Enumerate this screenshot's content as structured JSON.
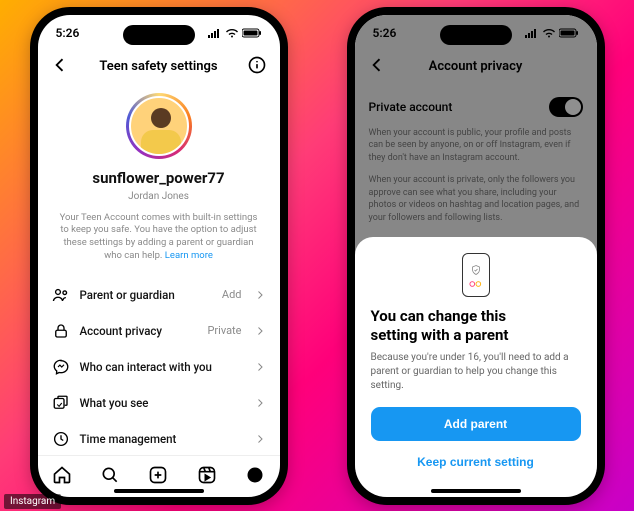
{
  "status_time": "5:26",
  "credit": "Instagram",
  "phone1": {
    "header_title": "Teen safety settings",
    "username": "sunflower_power77",
    "realname": "Jordan Jones",
    "desc_pre": "Your Teen Account comes with built-in settings to keep you safe. You have the option to adjust these settings by adding a parent or guardian who can help. ",
    "desc_link": "Learn more",
    "menu": [
      {
        "label": "Parent or guardian",
        "value": "Add"
      },
      {
        "label": "Account privacy",
        "value": "Private"
      },
      {
        "label": "Who can interact with you",
        "value": ""
      },
      {
        "label": "What you see",
        "value": ""
      },
      {
        "label": "Time management",
        "value": ""
      }
    ]
  },
  "phone2": {
    "header_title": "Account privacy",
    "row_label": "Private account",
    "para1": "When your account is public, your profile and posts can be seen by anyone, on or off Instagram, even if they don't have an Instagram account.",
    "para2": "When your account is private, only the followers you approve can see what you share, including your photos or videos on hashtag and location pages, and your followers and following lists.",
    "sheet": {
      "title_l1": "You can change this",
      "title_l2": "setting with a parent",
      "body": "Because you're under 16, you'll need to add a parent or guardian to help you change this setting.",
      "primary": "Add parent",
      "secondary": "Keep current setting"
    }
  }
}
